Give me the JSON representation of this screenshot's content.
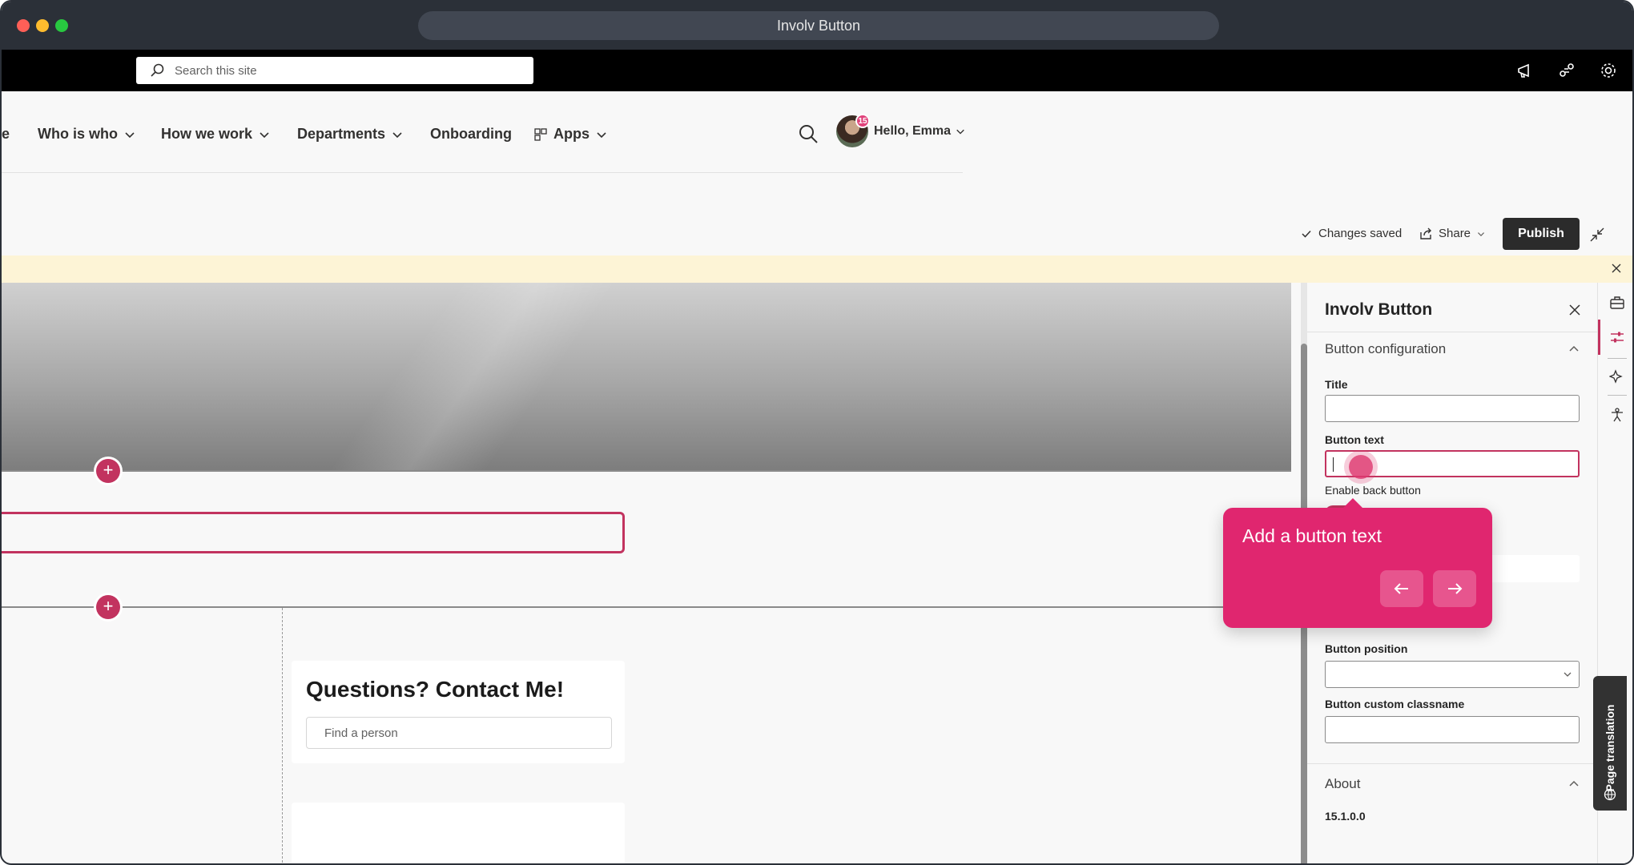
{
  "window": {
    "title": "Involv Button"
  },
  "suitebar": {
    "search_placeholder": "Search this site",
    "icons": [
      "megaphone-icon",
      "share-network-icon",
      "gear-icon"
    ]
  },
  "nav": {
    "items": [
      {
        "label": "e"
      },
      {
        "label": "Who is who"
      },
      {
        "label": "How we work"
      },
      {
        "label": "Departments"
      },
      {
        "label": "Onboarding"
      },
      {
        "label": "Apps"
      }
    ],
    "badge_count": "15",
    "greeting": "Hello, Emma"
  },
  "command": {
    "status": "Changes saved",
    "share": "Share",
    "publish": "Publish"
  },
  "canvas": {
    "contact_title": "Questions? Contact Me!",
    "find_placeholder": "Find a person"
  },
  "pane": {
    "title": "Involv Button",
    "section_config": "Button configuration",
    "fields": {
      "title_label": "Title",
      "title_value": "",
      "button_text_label": "Button text",
      "button_text_value": "",
      "enable_back_label": "Enable back button",
      "position_label": "Button position",
      "position_value": "",
      "classname_label": "Button custom classname",
      "classname_value": ""
    },
    "section_about": "About",
    "version": "15.1.0.0"
  },
  "rail": {
    "page_translation": "Page translation"
  },
  "guide": {
    "text": "Add a button text"
  },
  "colors": {
    "accent": "#c2335f",
    "guide": "#e0266f",
    "publish": "#2b2b2b"
  }
}
